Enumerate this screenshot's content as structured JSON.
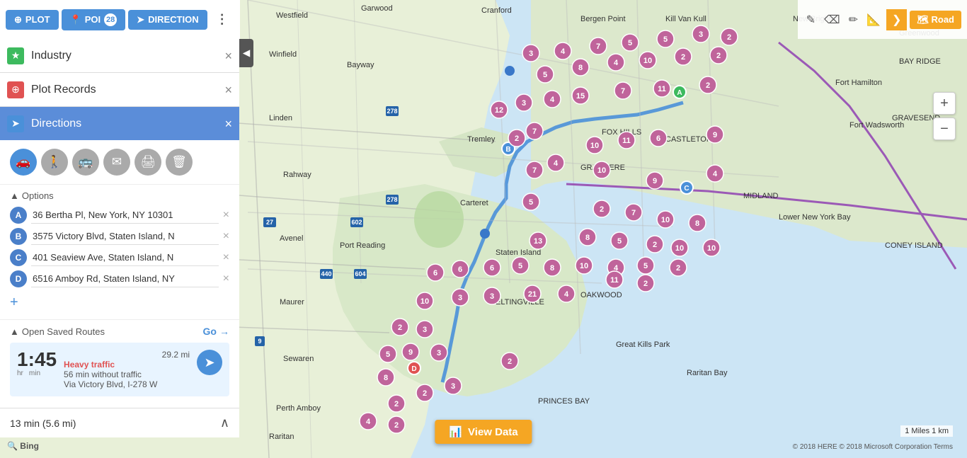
{
  "toolbar": {
    "plot_label": "PLOT",
    "poi_label": "POI",
    "poi_count": "28",
    "direction_label": "DIRECTION",
    "more_label": "⋮",
    "road_label": "Road",
    "arrow_label": "❯"
  },
  "panels": {
    "industry": {
      "title": "Industry",
      "close": "×"
    },
    "plot_records": {
      "title": "Plot Records",
      "close": "×"
    },
    "directions": {
      "title": "Directions",
      "close": "×"
    }
  },
  "directions": {
    "options_label": "Options",
    "waypoints": [
      {
        "label": "A",
        "value": "36 Bertha Pl, New York, NY 10301"
      },
      {
        "label": "B",
        "value": "3575 Victory Blvd, Staten Island, N"
      },
      {
        "label": "C",
        "value": "401 Seaview Ave, Staten Island, N"
      },
      {
        "label": "D",
        "value": "6516 Amboy Rd, Staten Island, NY"
      }
    ],
    "add_waypoint": "+",
    "saved_routes_label": "Open Saved Routes",
    "go_label": "Go",
    "route": {
      "time_value": "1:45",
      "time_hr": "hr",
      "time_min": "min",
      "traffic_label": "Heavy traffic",
      "no_traffic": "56 min without traffic",
      "via": "Via Victory Blvd, I-278 W",
      "distance": "29.2 mi"
    },
    "bottom_text": "13 min (5.6 mi)",
    "collapse": "∧"
  },
  "map_controls": {
    "zoom_in": "+",
    "zoom_out": "−"
  },
  "view_data_btn": "View Data",
  "map_scale": "1 Miles    1 km",
  "map_copyright": "© 2018 HERE © 2018 Microsoft Corporation  Terms",
  "bing_logo": "🔍 Bing"
}
